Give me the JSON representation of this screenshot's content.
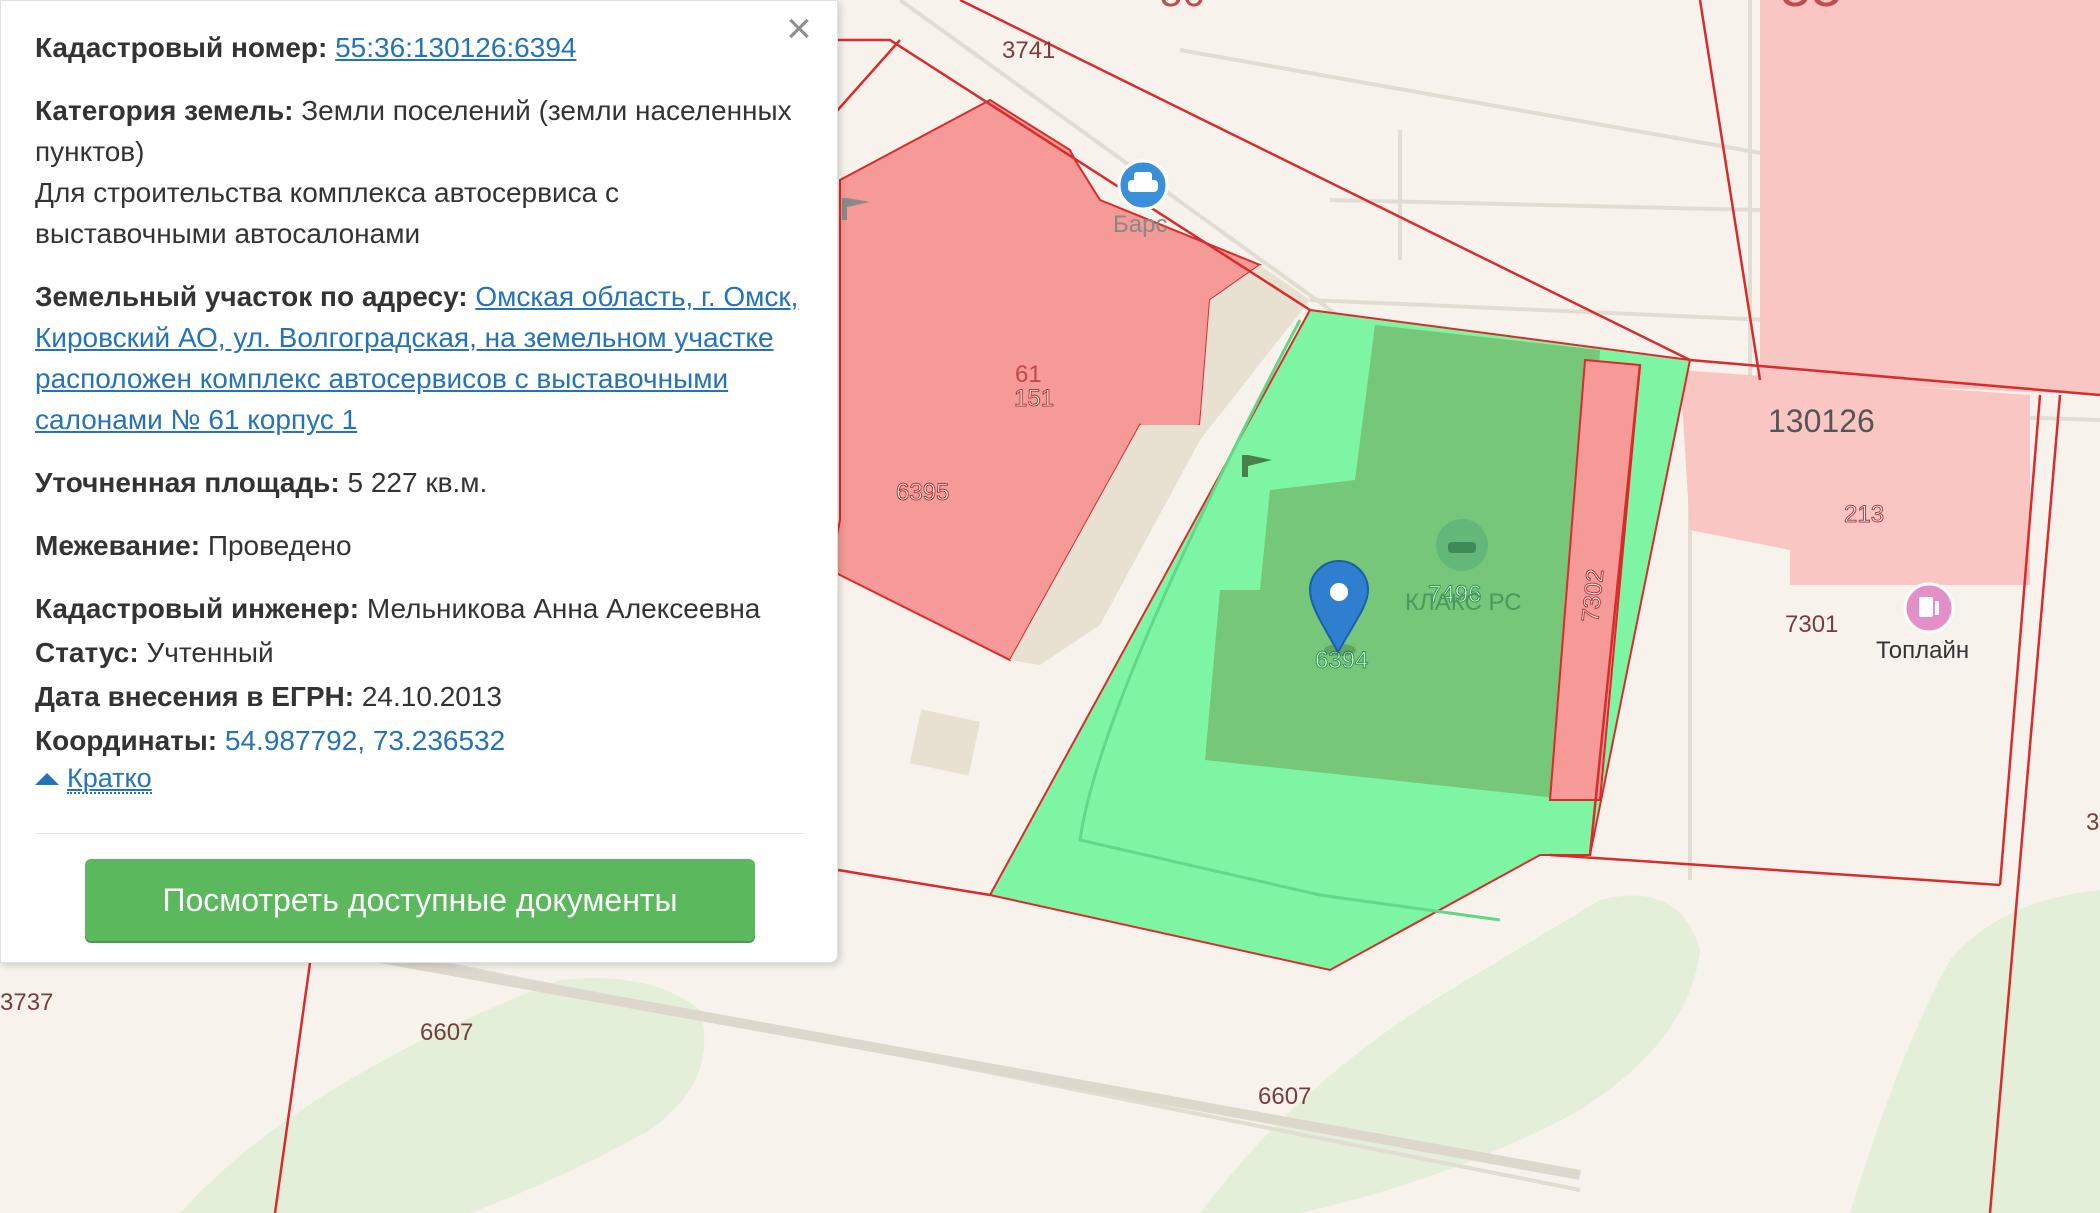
{
  "panel": {
    "cadastral_number_label": "Кадастровый номер:",
    "cadastral_number": "55:36:130126:6394",
    "land_category_label": "Категория земель:",
    "land_category": "Земли поселений (земли населенных пунктов)",
    "permitted_use": "Для строительства комплекса автосервиса с выставочными автосалонами",
    "address_label": "Земельный участок по адресу:",
    "address": "Омская область, г. Омск, Кировский АО, ул. Волгоградская, на земельном участке расположен комплекс автосервисов с выставочными салонами № 61 корпус 1",
    "area_label": "Уточненная площадь:",
    "area": "5 227 кв.м.",
    "survey_label": "Межевание:",
    "survey": "Проведено",
    "engineer_label": "Кадастровый инженер:",
    "engineer": "Мельникова Анна Алексеевна",
    "status_label": "Статус:",
    "status": "Учтенный",
    "egrn_date_label": "Дата внесения в ЕГРН:",
    "egrn_date": "24.10.2013",
    "coords_label": "Координаты:",
    "coords": "54.987792, 73.236532",
    "collapse_label": "Кратко",
    "docs_button": "Посмотреть доступные документы",
    "close_icon": "close-icon"
  },
  "map": {
    "labels": {
      "top_partial_a": "56",
      "top_partial_b": "55",
      "road_3741": "3741",
      "poi_bars": "Барс",
      "parcel_61": "61",
      "parcel_151": "151",
      "parcel_6395": "6395",
      "parcel_6394": "6394",
      "parcel_7496": "7496",
      "poi_partial": "КЛАКС РС",
      "parcel_7302": "7302",
      "quarter_130126": "130126",
      "parcel_213": "213",
      "parcel_7301": "7301",
      "poi_toplain": "Топлайн",
      "road_3737": "3737",
      "road_6607_a": "6607",
      "road_6607_b": "6607",
      "edge_3": "3"
    },
    "icons": {
      "car_service": "car-service-icon",
      "fuel": "fuel-station-icon",
      "pin": "map-pin-icon"
    },
    "colors": {
      "selected_parcel": "#7ef5a3",
      "building_on_selected": "#76c77a",
      "neighbor_parcel": "#f59a96",
      "quarter_fill": "#f9c6c4",
      "boundary": "#d92b2b",
      "greenery": "#e4efda",
      "background": "#f7f3ec",
      "link": "#2573b7",
      "button": "#5bb85d"
    }
  }
}
